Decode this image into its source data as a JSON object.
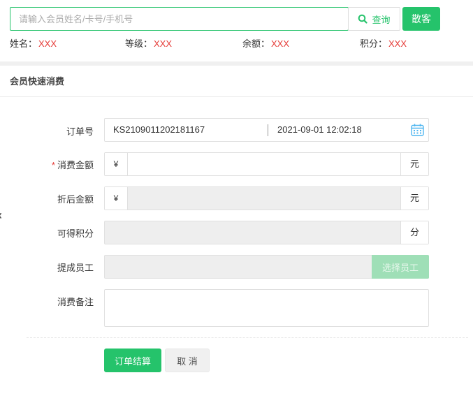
{
  "search": {
    "placeholder": "请输入会员姓名/卡号/手机号",
    "value": "",
    "query_label": "查询",
    "walkin_label": "散客"
  },
  "member_info": [
    {
      "label": "姓名：",
      "value": "XXX"
    },
    {
      "label": "等级：",
      "value": "XXX"
    },
    {
      "label": "余额：",
      "value": "XXX"
    },
    {
      "label": "积分：",
      "value": "XXX"
    }
  ],
  "section": {
    "title": "会员快速消费"
  },
  "form": {
    "order_no": {
      "label": "订单号",
      "number": "KS2109011202181167",
      "time": "2021-09-01 12:02:18"
    },
    "amount": {
      "required_mark": "*",
      "label": "消费金额",
      "prefix": "¥",
      "suffix": "元",
      "value": ""
    },
    "discount": {
      "label": "折后金额",
      "prefix": "¥",
      "suffix": "元",
      "value": ""
    },
    "points": {
      "label": "可得积分",
      "suffix": "分",
      "value": ""
    },
    "staff": {
      "label": "提成员工",
      "button": "选择员工",
      "value": ""
    },
    "note": {
      "label": "消费备注",
      "value": ""
    }
  },
  "actions": {
    "submit": "订单结算",
    "cancel": "取 消"
  },
  "side": {
    "arrow": "‹"
  },
  "colors": {
    "accent": "#25c36b",
    "accent_disabled": "#9fdfb7",
    "value_red": "#e53935"
  }
}
